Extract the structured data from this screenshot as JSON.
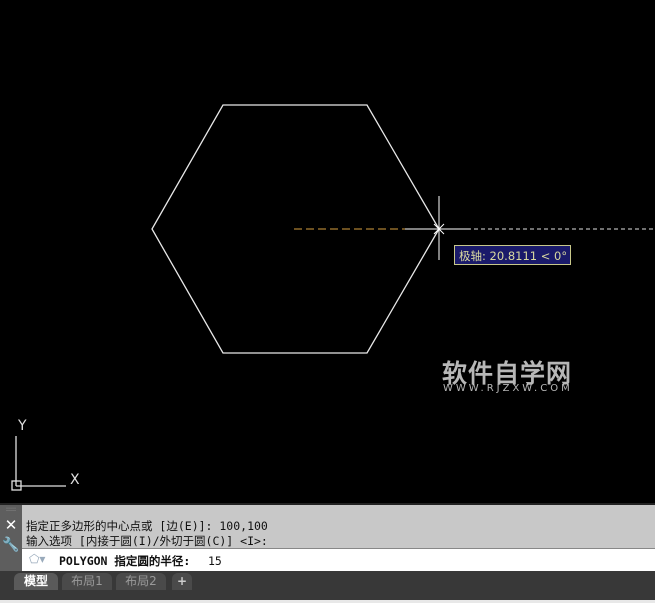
{
  "tooltip": {
    "label": "极轴: 20.8111 < 0°"
  },
  "watermark": {
    "title": "软件自学网",
    "url": "WWW.RJZXW.COM"
  },
  "ucs": {
    "x": "X",
    "y": "Y"
  },
  "command": {
    "history": [
      "指定正多边形的中心点或 [边(E)]: 100,100",
      "输入选项 [内接于圆(I)/外切于圆(C)] <I>:"
    ],
    "prompt": "POLYGON 指定圆的半径:",
    "value": "15"
  },
  "tabs": [
    {
      "label": "模型",
      "active": true
    },
    {
      "label": "布局1"
    },
    {
      "label": "布局2"
    },
    {
      "label": "+"
    }
  ]
}
